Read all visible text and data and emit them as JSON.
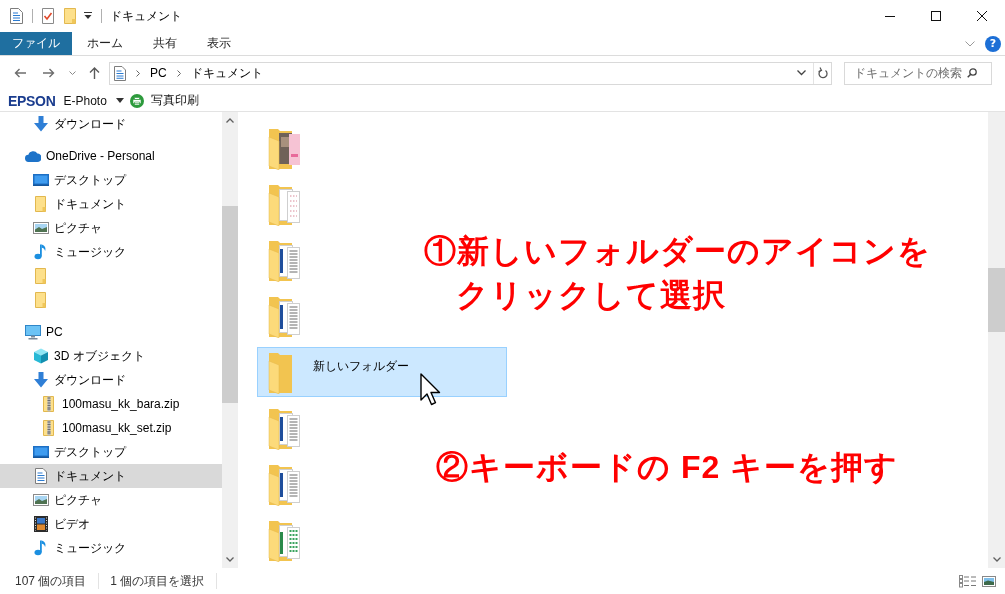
{
  "window": {
    "title": "ドキュメント"
  },
  "ribbon": {
    "tabs": [
      {
        "label": "ファイル",
        "kind": "file",
        "selected": false
      },
      {
        "label": "ホーム",
        "kind": "tab",
        "selected": false
      },
      {
        "label": "共有",
        "kind": "tab",
        "selected": false
      },
      {
        "label": "表示",
        "kind": "tab",
        "selected": false
      }
    ],
    "help": "?"
  },
  "address_bar": {
    "path": [
      "PC",
      "ドキュメント"
    ]
  },
  "search": {
    "placeholder": "ドキュメントの検索"
  },
  "epson_toolbar": {
    "brand": "EPSON",
    "app": "E-Photo",
    "action": "写真印刷"
  },
  "sidebar": {
    "items": [
      {
        "children": [
          {
            "label": "ダウンロード",
            "kind": "download",
            "selected": false
          }
        ]
      },
      {
        "label": "OneDrive - Personal",
        "kind": "cloud",
        "selected": false,
        "children": [
          {
            "label": "デスクトップ",
            "kind": "desktop",
            "selected": false
          },
          {
            "label": "ドキュメント",
            "kind": "folder",
            "selected": false
          },
          {
            "label": "ピクチャ",
            "kind": "pictures",
            "selected": false
          },
          {
            "label": "ミュージック",
            "kind": "music",
            "selected": false
          },
          {
            "kind": "folder",
            "selected": false
          },
          {
            "kind": "folder",
            "selected": false
          }
        ]
      },
      {
        "label": "PC",
        "kind": "pc",
        "selected": false,
        "children": [
          {
            "label": "3D オブジェクト",
            "kind": "cube",
            "selected": false
          },
          {
            "label": "ダウンロード",
            "kind": "download",
            "selected": false,
            "children": [
              {
                "label": "100masu_kk_bara.zip",
                "kind": "zip",
                "selected": false
              },
              {
                "label": "100masu_kk_set.zip",
                "kind": "zip",
                "selected": false
              }
            ]
          },
          {
            "label": "デスクトップ",
            "kind": "desktop",
            "selected": false
          },
          {
            "label": "ドキュメント",
            "kind": "documents",
            "selected": true
          },
          {
            "label": "ピクチャ",
            "kind": "pictures",
            "selected": false
          },
          {
            "label": "ビデオ",
            "kind": "video",
            "selected": false
          },
          {
            "label": "ミュージック",
            "kind": "music",
            "selected": false
          }
        ]
      }
    ]
  },
  "files": {
    "items": [
      {
        "kind": "photo_folder",
        "selected": false
      },
      {
        "kind": "print_folder",
        "selected": false
      },
      {
        "kind": "doc_folder",
        "selected": false
      },
      {
        "kind": "doc_folder",
        "selected": false
      },
      {
        "kind": "folder",
        "name": "新しいフォルダー",
        "selected": true
      },
      {
        "kind": "doc_folder",
        "selected": false
      },
      {
        "kind": "doc_folder",
        "selected": false
      },
      {
        "kind": "sheet_folder",
        "selected": false
      }
    ]
  },
  "annotations": [
    {
      "lines": [
        "①新しいフォルダーのアイコンを",
        "クリックして選択"
      ]
    },
    {
      "lines": [
        "②キーボードの F2 キーを押す"
      ]
    }
  ],
  "status_bar": {
    "item_count": "107 個の項目",
    "selection": "1 個の項目を選択"
  }
}
